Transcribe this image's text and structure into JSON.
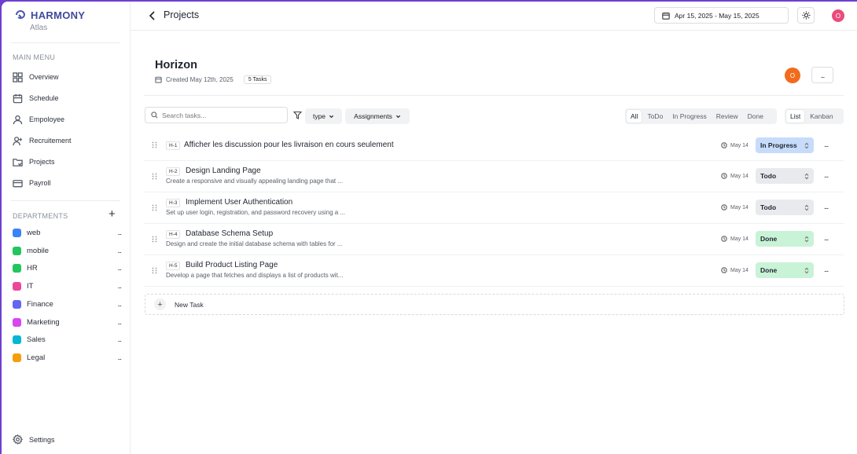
{
  "brand": {
    "name": "HARMONY",
    "subtitle": "Atlas"
  },
  "sidebar": {
    "main_menu_label": "MAIN MENU",
    "items": [
      {
        "label": "Overview",
        "icon": "grid-icon"
      },
      {
        "label": "Schedule",
        "icon": "calendar-icon"
      },
      {
        "label": "Empoloyee",
        "icon": "user-icon"
      },
      {
        "label": "Recruitement",
        "icon": "user-plus-icon"
      },
      {
        "label": "Projects",
        "icon": "folder-icon"
      },
      {
        "label": "Payroll",
        "icon": "card-icon"
      }
    ],
    "departments_label": "DEPARTMENTS",
    "add_symbol": "+",
    "departments": [
      {
        "label": "web",
        "color": "#3b82f6"
      },
      {
        "label": "mobile",
        "color": "#22c55e"
      },
      {
        "label": "HR",
        "color": "#22c55e"
      },
      {
        "label": "IT",
        "color": "#ec4899"
      },
      {
        "label": "Finance",
        "color": "#6366f1"
      },
      {
        "label": "Marketing",
        "color": "#d946ef"
      },
      {
        "label": "Sales",
        "color": "#06b6d4"
      },
      {
        "label": "Legal",
        "color": "#f59e0b"
      }
    ],
    "more_symbol": "...",
    "settings_label": "Settings"
  },
  "topbar": {
    "title": "Projects",
    "date_range": "Apr 15, 2025 - May 15, 2025",
    "user_initial": "O"
  },
  "project": {
    "name": "Horizon",
    "created": "Created May 12th, 2025",
    "task_count": "5 Tasks",
    "owner_initial": "O",
    "more": "..."
  },
  "toolbar": {
    "search_placeholder": "Search tasks...",
    "type_label": "type",
    "assignments_label": "Assignments",
    "status_tabs": [
      "All",
      "ToDo",
      "In Progress",
      "Review",
      "Done"
    ],
    "view_tabs": [
      "List",
      "Kanban"
    ]
  },
  "tasks": [
    {
      "id": "H-1",
      "title": "Afficher les discussion pour les livraison en cours seulement",
      "description": "",
      "due": "May 14",
      "status": "In Progress"
    },
    {
      "id": "H-2",
      "title": "Design Landing Page",
      "description": "Create a responsive and visually appealing landing page that ...",
      "due": "May 14",
      "status": "Todo"
    },
    {
      "id": "H-3",
      "title": "Implement User Authentication",
      "description": "Set up user login, registration, and password recovery using a ...",
      "due": "May 14",
      "status": "Todo"
    },
    {
      "id": "H-4",
      "title": "Database Schema Setup",
      "description": "Design and create the initial database schema with tables for ...",
      "due": "May 14",
      "status": "Done"
    },
    {
      "id": "H-5",
      "title": "Build Product Listing Page",
      "description": "Develop a page that fetches and displays a list of products wit...",
      "due": "May 14",
      "status": "Done"
    }
  ],
  "status_colors": {
    "In Progress": "#c7dcfb",
    "Todo": "#e9eaee",
    "Done": "#c9f3d6"
  },
  "row_more": "...",
  "new_task_label": "New Task",
  "new_task_symbol": "+"
}
